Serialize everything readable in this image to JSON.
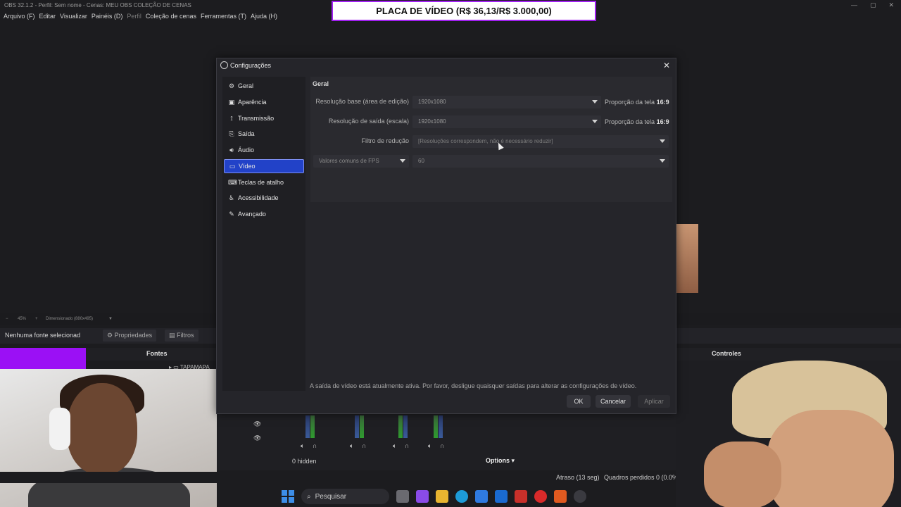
{
  "window": {
    "title": "OBS 32.1.2 - Perfil: Sem nome - Cenas: MEU OBS COLEÇÃO DE CENAS"
  },
  "menu": [
    "Arquivo (F)",
    "Editar",
    "Visualizar",
    "Painéis (D)",
    "Perfil",
    "Coleção de cenas",
    "Ferramentas (T)",
    "Ajuda (H)"
  ],
  "banner": {
    "text": "PLACA DE VÍDEO (R$ 36,13/R$ 3.000,00)"
  },
  "preview": {
    "zoom": "45%",
    "scale_label": "Dimensionado (880x495)"
  },
  "sources_toolbar": {
    "no_source": "Nenhuma fonte selecionad",
    "properties": "Propriedades",
    "filters": "Filtros"
  },
  "docks": {
    "fontes": "Fontes",
    "controles": "Controles",
    "source_item": "TAPAMAPA"
  },
  "mixer": {
    "hidden": "0 hidden",
    "options": "Options"
  },
  "status": {
    "atraso": "Atraso (13 seg)",
    "quadros": "Quadros perdidos 0 (0.0%)"
  },
  "taskbar": {
    "search": "Pesquisar"
  },
  "dialog": {
    "title": "Configurações",
    "sidebar": [
      {
        "label": "Geral",
        "icon": "gear-icon",
        "glyph": "⚙",
        "active": false
      },
      {
        "label": "Aparência",
        "icon": "appearance-icon",
        "glyph": "▣",
        "active": false
      },
      {
        "label": "Transmissão",
        "icon": "antenna-icon",
        "glyph": "⟟",
        "active": false
      },
      {
        "label": "Saída",
        "icon": "output-icon",
        "glyph": "⎘",
        "active": false
      },
      {
        "label": "Áudio",
        "icon": "speaker-icon",
        "glyph": "🔊︎",
        "active": false
      },
      {
        "label": "Vídeo",
        "icon": "monitor-icon",
        "glyph": "▭",
        "active": true
      },
      {
        "label": "Teclas de atalho",
        "icon": "keyboard-icon",
        "glyph": "⌨",
        "active": false
      },
      {
        "label": "Acessibilidade",
        "icon": "accessibility-icon",
        "glyph": "♿︎",
        "active": false
      },
      {
        "label": "Avançado",
        "icon": "wrench-icon",
        "glyph": "✎",
        "active": false
      }
    ],
    "group_title": "Geral",
    "base_res": {
      "label": "Resolução base (área de edição)",
      "value": "1920x1080",
      "ratio_prefix": "Proporção da tela",
      "ratio": "16:9"
    },
    "out_res": {
      "label": "Resolução de saída (escala)",
      "value": "1920x1080",
      "ratio_prefix": "Proporção da tela",
      "ratio": "16:9"
    },
    "filter": {
      "label": "Filtro de redução",
      "value": "[Resoluções correspondem, não é necessário reduzir]"
    },
    "fps": {
      "type": "Valores comuns de FPS",
      "value": "60"
    },
    "warning": "A saída de vídeo está atualmente ativa. Por favor, desligue quaisquer saídas para alterar as configurações de vídeo.",
    "buttons": {
      "ok": "OK",
      "cancel": "Cancelar",
      "apply": "Aplicar"
    }
  },
  "colors": {
    "accent": "#2242c8",
    "banner_border": "#a020f0",
    "overlay_purple": "#9b10f5"
  }
}
